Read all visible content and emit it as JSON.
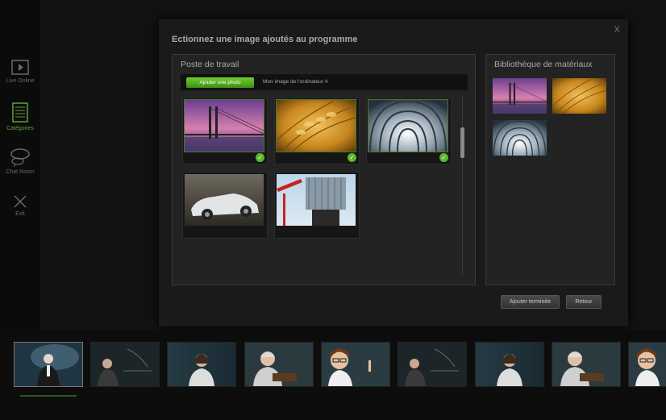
{
  "sidebar": {
    "items": [
      {
        "label": "Live Online",
        "icon": "play-icon"
      },
      {
        "label": "Catégories",
        "icon": "list-icon"
      },
      {
        "label": "Chat Room",
        "icon": "chat-icon"
      },
      {
        "label": "Exit",
        "icon": "exit-icon"
      }
    ],
    "active_color": "#5ea33a"
  },
  "dialog": {
    "title": "Ectionnez une image ajoutés au programme",
    "close_label": "X",
    "workstation": {
      "title": "Poste de travail",
      "add_button": "Ajouter une photo",
      "computer_label": "Mon image de l'ordinateur",
      "computer_count": "4",
      "photos": [
        {
          "subject": "bridge-sunset",
          "selected": true
        },
        {
          "subject": "wheat-closeup",
          "selected": true
        },
        {
          "subject": "glass-tunnel",
          "selected": true
        },
        {
          "subject": "silver-convertible",
          "selected": false
        },
        {
          "subject": "industrial-tower",
          "selected": false
        }
      ]
    },
    "library": {
      "title": "Bibliothèque de matériaux",
      "photos": [
        "bridge-sunset",
        "wheat-closeup",
        "glass-tunnel"
      ]
    },
    "buttons": {
      "done": "Ajouter terminée",
      "back": "Retour"
    }
  },
  "filmstrip": {
    "thumbs": [
      "scientist-presenter",
      "teacher-blackboard",
      "woman-teacher",
      "professor-book",
      "woman-glasses",
      "teacher-blackboard",
      "woman-teacher",
      "professor-book",
      "woman-glasses"
    ]
  },
  "colors": {
    "accent": "#5bb82a",
    "background": "#0a0a0a"
  }
}
